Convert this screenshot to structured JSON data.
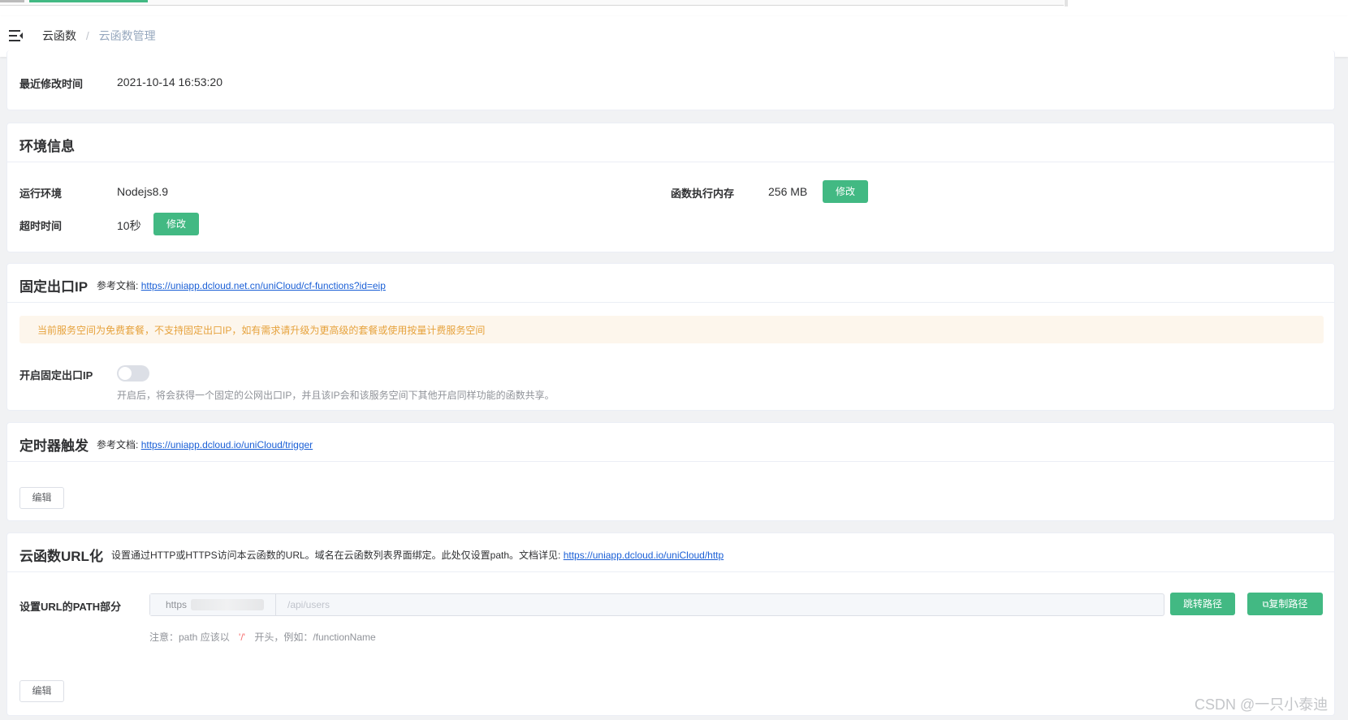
{
  "breadcrumb": {
    "home": "云函数",
    "separator": "/",
    "current": "云函数管理"
  },
  "basic": {
    "modified_label": "最近修改时间",
    "modified_value": "2021-10-14 16:53:20"
  },
  "env": {
    "title": "环境信息",
    "runtime_label": "运行环境",
    "runtime_value": "Nodejs8.9",
    "memory_label": "函数执行内存",
    "memory_value": "256 MB",
    "memory_edit": "修改",
    "timeout_label": "超时时间",
    "timeout_value": "10秒",
    "timeout_edit": "修改"
  },
  "fixed_ip": {
    "title": "固定出口IP",
    "doc_prefix": "参考文档:",
    "doc_link": "https://uniapp.dcloud.net.cn/uniCloud/cf-functions?id=eip",
    "warning": "当前服务空间为免费套餐，不支持固定出口IP，如有需求请升级为更高级的套餐或使用按量计费服务空间",
    "toggle_label": "开启固定出口IP",
    "toggle_on": false,
    "hint": "开启后，将会获得一个固定的公网出口IP，并且该IP会和该服务空间下其他开启同样功能的函数共享。"
  },
  "timer": {
    "title": "定时器触发",
    "doc_prefix": "参考文档:",
    "doc_link": "https://uniapp.dcloud.io/uniCloud/trigger",
    "edit": "编辑"
  },
  "url": {
    "title": "云函数URL化",
    "desc": "设置通过HTTP或HTTPS访问本云函数的URL。域名在云函数列表界面绑定。此处仅设置path。文档详见:",
    "doc_link": "https://uniapp.dcloud.io/uniCloud/http",
    "path_label": "设置URL的PATH部分",
    "prefix": "https",
    "placeholder": "/api/users",
    "jump_button": "跳转路径",
    "copy_button": "复制路径",
    "note_prefix": "注意：path 应该以",
    "note_slash": "'/'",
    "note_suffix": "开头，例如：/functionName",
    "edit": "编辑"
  },
  "watermark": "CSDN @一只小泰迪",
  "colors": {
    "accent": "#42b983",
    "link": "#1a5fd6",
    "warning_text": "#e6a23c",
    "warning_bg": "#fdf6ec"
  },
  "icons": {
    "menu": "hamburger-fold-icon",
    "copy": "copy-icon"
  }
}
